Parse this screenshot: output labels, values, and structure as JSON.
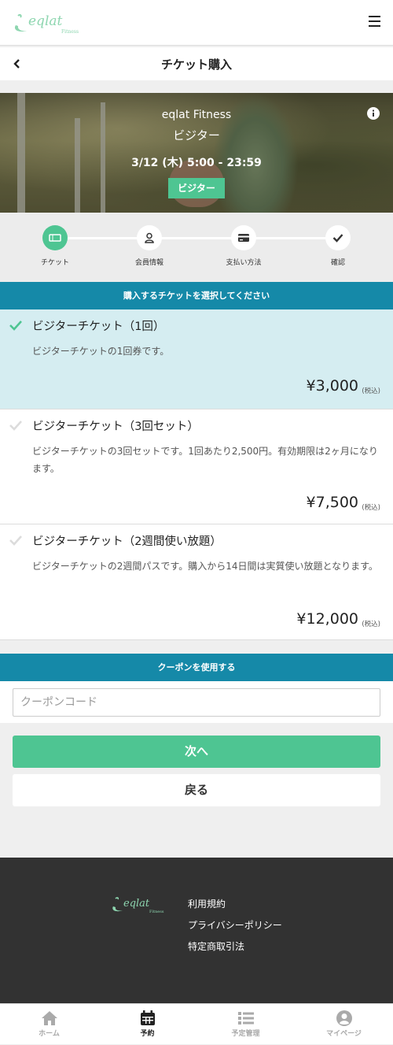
{
  "header": {
    "logo_text": "eqlat",
    "logo_sub": "Fitness"
  },
  "titlebar": {
    "title": "チケット購入"
  },
  "hero": {
    "gym": "eqlat Fitness",
    "plan": "ビジター",
    "date": "3/12 (木) 5:00 - 23:59",
    "badge": "ビジター"
  },
  "steps": [
    {
      "label": "チケット",
      "icon": "ticket-icon",
      "active": true
    },
    {
      "label": "会員情報",
      "icon": "user-icon",
      "active": false
    },
    {
      "label": "支払い方法",
      "icon": "credit-card-icon",
      "active": false
    },
    {
      "label": "確認",
      "icon": "check-icon",
      "active": false
    }
  ],
  "ticket_section": {
    "heading": "購入するチケットを選択してください"
  },
  "tickets": [
    {
      "name": "ビジターチケット（1回）",
      "desc": "ビジターチケットの1回券です。",
      "price": "¥3,000",
      "tax": "(税込)",
      "selected": true
    },
    {
      "name": "ビジターチケット（3回セット）",
      "desc": "ビジターチケットの3回セットです。1回あたり2,500円。有効期限は2ヶ月になります。",
      "price": "¥7,500",
      "tax": "(税込)",
      "selected": false
    },
    {
      "name": "ビジターチケット（2週間使い放題）",
      "desc": "ビジターチケットの2週間パスです。購入から14日間は実質使い放題となります。",
      "price": "¥12,000",
      "tax": "(税込)",
      "selected": false
    }
  ],
  "coupon": {
    "heading": "クーポンを使用する",
    "placeholder": "クーポンコード",
    "value": ""
  },
  "buttons": {
    "next": "次へ",
    "back": "戻る"
  },
  "footer": {
    "links": [
      "利用規約",
      "プライバシーポリシー",
      "特定商取引法"
    ]
  },
  "tabs": [
    {
      "label": "ホーム",
      "icon": "home-icon",
      "active": false
    },
    {
      "label": "予約",
      "icon": "calendar-icon",
      "active": true
    },
    {
      "label": "予定管理",
      "icon": "list-icon",
      "active": false
    },
    {
      "label": "マイページ",
      "icon": "user-circle-icon",
      "active": false
    }
  ],
  "colors": {
    "accent": "#4ec592",
    "band": "#1589a8",
    "selected_bg": "#d5edf1",
    "footer_bg": "#323232"
  }
}
